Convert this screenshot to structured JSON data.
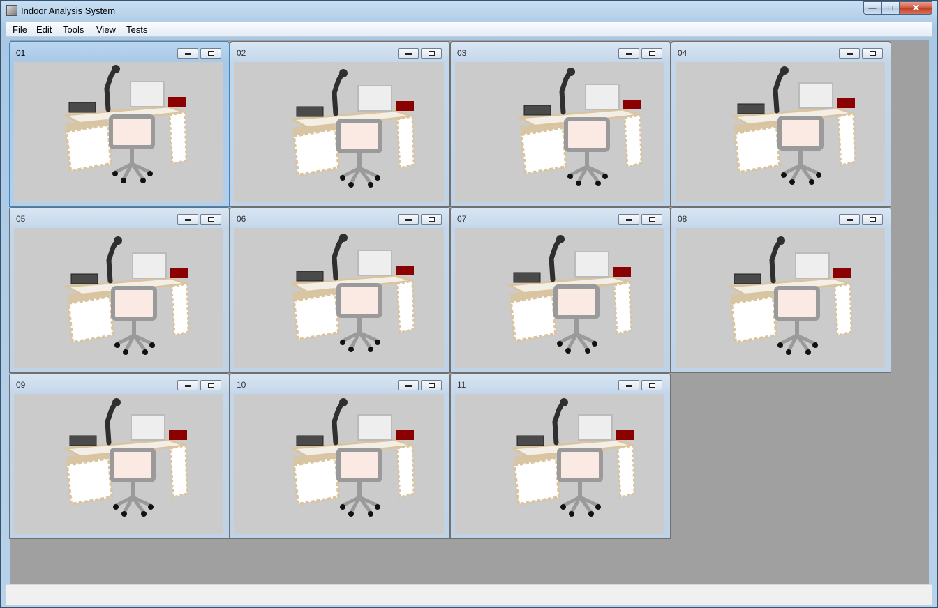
{
  "window": {
    "title": "Indoor Analysis System"
  },
  "menu": [
    "File",
    "Edit",
    "Tools",
    "View",
    "Tests"
  ],
  "children": [
    {
      "title": "01",
      "active": true
    },
    {
      "title": "02"
    },
    {
      "title": "03"
    },
    {
      "title": "04"
    },
    {
      "title": "05"
    },
    {
      "title": "06"
    },
    {
      "title": "07"
    },
    {
      "title": "08"
    },
    {
      "title": "09"
    },
    {
      "title": "10"
    },
    {
      "title": "11"
    }
  ],
  "colors": {
    "viewport_background": "#cbcbcb",
    "mdi_background": "#a0a0a0",
    "desk": "#d9c49e",
    "cabinet": "#ffffff",
    "monitor": "#eeeeee",
    "chair_seat": "#fbe9e3",
    "chair_frame": "#9a9a9a",
    "lamp": "#2f2f2f",
    "red_object": "#8b0000"
  }
}
